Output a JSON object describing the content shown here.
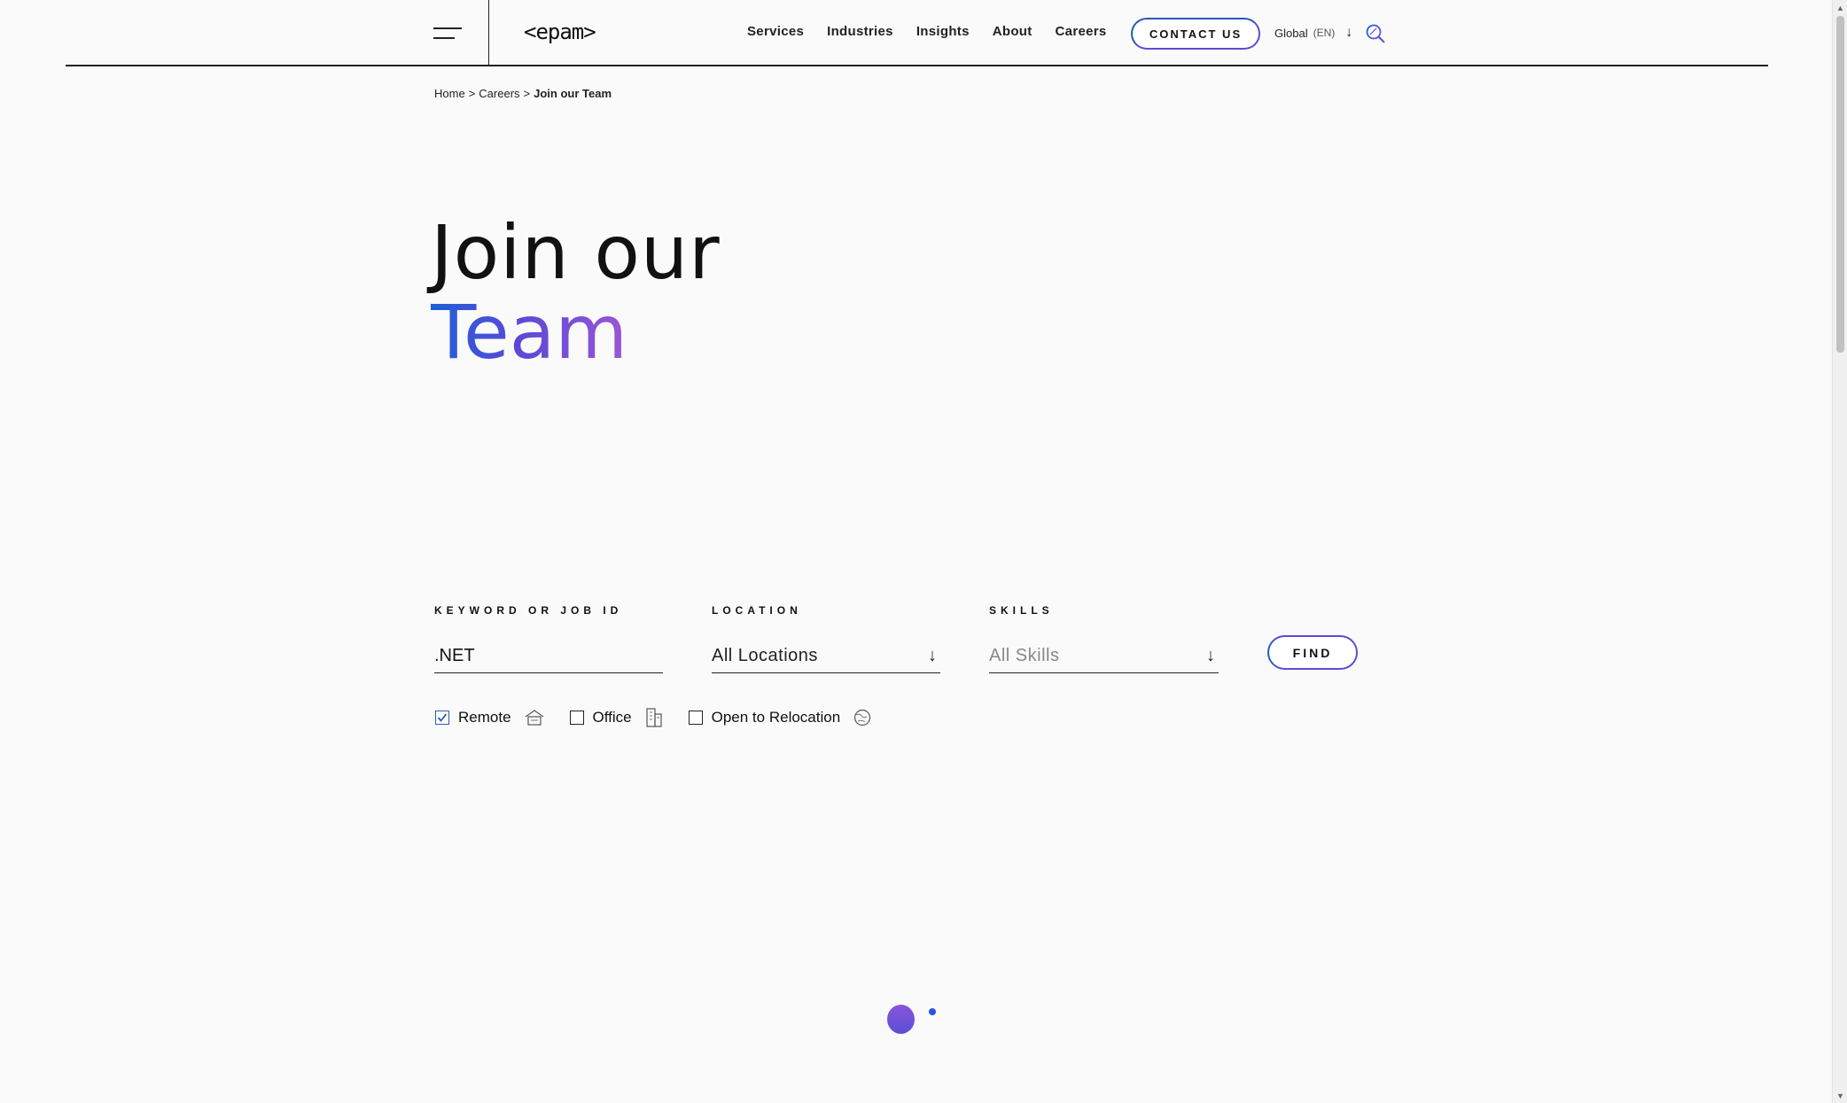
{
  "header": {
    "logo": "<epam>",
    "nav": [
      "Services",
      "Industries",
      "Insights",
      "About",
      "Careers"
    ],
    "contact_label": "CONTACT US",
    "lang_label": "Global",
    "lang_code": "(EN)"
  },
  "breadcrumb": {
    "home": "Home",
    "sep": ">",
    "careers": "Careers",
    "current": "Join our Team"
  },
  "hero": {
    "line1": "Join our",
    "line2": "Team"
  },
  "filters": {
    "keyword_label": "KEYWORD OR JOB ID",
    "keyword_value": ".NET",
    "location_label": "LOCATION",
    "location_value": "All Locations",
    "skills_label": "SKILLS",
    "skills_placeholder": "All Skills",
    "find_label": "FIND",
    "options": [
      {
        "label": "Remote",
        "checked": true,
        "icon": "home-icon"
      },
      {
        "label": "Office",
        "checked": false,
        "icon": "building-icon"
      },
      {
        "label": "Open to Relocation",
        "checked": false,
        "icon": "globe-icon"
      }
    ]
  },
  "colors": {
    "accent_blue": "#1f5fd8",
    "accent_purple": "#9a57d6",
    "text": "#111111",
    "background": "#fafafa"
  }
}
